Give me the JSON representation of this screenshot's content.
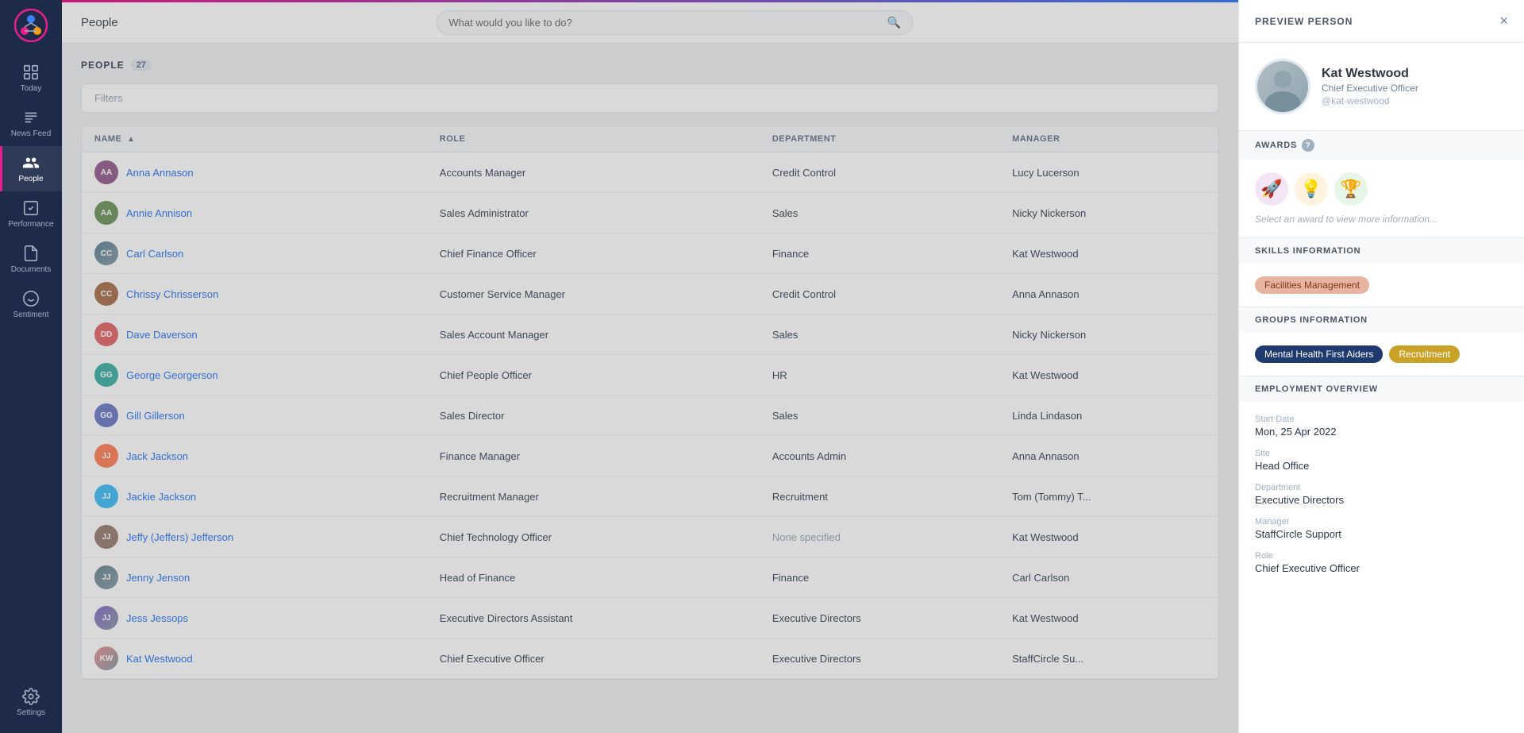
{
  "sidebar": {
    "logo_label": "StaffCircle",
    "items": [
      {
        "id": "today",
        "label": "Today",
        "icon": "grid"
      },
      {
        "id": "news-feed",
        "label": "News Feed",
        "icon": "newspaper"
      },
      {
        "id": "people",
        "label": "People",
        "icon": "people",
        "active": true
      },
      {
        "id": "performance",
        "label": "Performance",
        "icon": "check-square"
      },
      {
        "id": "documents",
        "label": "Documents",
        "icon": "file"
      },
      {
        "id": "sentiment",
        "label": "Sentiment",
        "icon": "smile"
      }
    ],
    "settings_label": "Settings"
  },
  "topbar": {
    "title": "People",
    "search_placeholder": "What would you like to do?"
  },
  "people_list": {
    "heading": "PEOPLE",
    "count": "27",
    "filters_label": "Filters",
    "columns": [
      {
        "id": "name",
        "label": "NAME",
        "sortable": true
      },
      {
        "id": "role",
        "label": "ROLE"
      },
      {
        "id": "department",
        "label": "DEPARTMENT"
      },
      {
        "id": "manager",
        "label": "MANAGER"
      }
    ],
    "rows": [
      {
        "initials": "AA",
        "color": "#9c6b98",
        "name": "Anna Annason",
        "role": "Accounts Manager",
        "department": "Credit Control",
        "manager": "Lucy Lucerson",
        "has_photo": false
      },
      {
        "initials": "AA",
        "color": "#7b9e6b",
        "name": "Annie Annison",
        "role": "Sales Administrator",
        "department": "Sales",
        "manager": "Nicky Nickerson",
        "has_photo": false
      },
      {
        "initials": "CC",
        "color": "#6b8e9e",
        "name": "Carl Carlson",
        "role": "Chief Finance Officer",
        "department": "Finance",
        "manager": "Kat Westwood",
        "has_photo": true
      },
      {
        "initials": "CC",
        "color": "#b07d5c",
        "name": "Chrissy Chrisserson",
        "role": "Customer Service Manager",
        "department": "Credit Control",
        "manager": "Anna Annason",
        "has_photo": false
      },
      {
        "initials": "DD",
        "color": "#e57373",
        "name": "Dave Daverson",
        "role": "Sales Account Manager",
        "department": "Sales",
        "manager": "Nicky Nickerson",
        "has_photo": false
      },
      {
        "initials": "GG",
        "color": "#4db6ac",
        "name": "George Georgerson",
        "role": "Chief People Officer",
        "department": "HR",
        "manager": "Kat Westwood",
        "has_photo": false
      },
      {
        "initials": "GG",
        "color": "#7986cb",
        "name": "Gill Gillerson",
        "role": "Sales Director",
        "department": "Sales",
        "manager": "Linda Lindason",
        "has_photo": false
      },
      {
        "initials": "JJ",
        "color": "#ff8a65",
        "name": "Jack Jackson",
        "role": "Finance Manager",
        "department": "Accounts Admin",
        "manager": "Anna Annason",
        "has_photo": false
      },
      {
        "initials": "JJ",
        "color": "#4fc3f7",
        "name": "Jackie Jackson",
        "role": "Recruitment Manager",
        "department": "Recruitment",
        "manager": "Tom (Tommy) T...",
        "has_photo": false
      },
      {
        "initials": "JJ",
        "color": "#a1887f",
        "name": "Jeffy (Jeffers) Jefferson",
        "role": "Chief Technology Officer",
        "department": "None specified",
        "manager": "Kat Westwood",
        "has_photo": false
      },
      {
        "initials": "JJ",
        "color": "#78909c",
        "name": "Jenny Jenson",
        "role": "Head of Finance",
        "department": "Finance",
        "manager": "Carl Carlson",
        "has_photo": true
      },
      {
        "initials": "JJ",
        "color": "#9575cd",
        "name": "Jess Jessops",
        "role": "Executive Directors Assistant",
        "department": "Executive Directors",
        "manager": "Kat Westwood",
        "has_photo": true
      },
      {
        "initials": "KW",
        "color": "#ef9a9a",
        "name": "Kat Westwood",
        "role": "Chief Executive Officer",
        "department": "Executive Directors",
        "manager": "StaffCircle Su...",
        "has_photo": true
      }
    ]
  },
  "preview_panel": {
    "title": "PREVIEW PERSON",
    "close_label": "×",
    "person": {
      "name": "Kat Westwood",
      "role": "Chief Executive Officer",
      "handle": "@kat-westwood"
    },
    "awards_section": {
      "title": "AWARDS",
      "help_text": "?",
      "select_text": "Select an award to view more information...",
      "awards": [
        {
          "id": "award-1",
          "emoji": "🚀",
          "bg": "#f3e5f5"
        },
        {
          "id": "award-2",
          "emoji": "💡",
          "bg": "#fff8e1"
        },
        {
          "id": "award-3",
          "emoji": "🏆",
          "bg": "#e8f5e9"
        }
      ]
    },
    "skills_section": {
      "title": "SKILLS INFORMATION",
      "skills": [
        "Facilities Management"
      ]
    },
    "groups_section": {
      "title": "GROUPS INFORMATION",
      "groups": [
        {
          "label": "Mental Health First Aiders",
          "style": "blue"
        },
        {
          "label": "Recruitment",
          "style": "gold"
        }
      ]
    },
    "employment_section": {
      "title": "EMPLOYMENT OVERVIEW",
      "fields": [
        {
          "label": "Start Date",
          "value": "Mon, 25 Apr 2022"
        },
        {
          "label": "Site",
          "value": "Head Office"
        },
        {
          "label": "Department",
          "value": "Executive Directors"
        },
        {
          "label": "Manager",
          "value": "StaffCircle Support"
        },
        {
          "label": "Role",
          "value": "Chief Executive Officer"
        }
      ]
    }
  }
}
